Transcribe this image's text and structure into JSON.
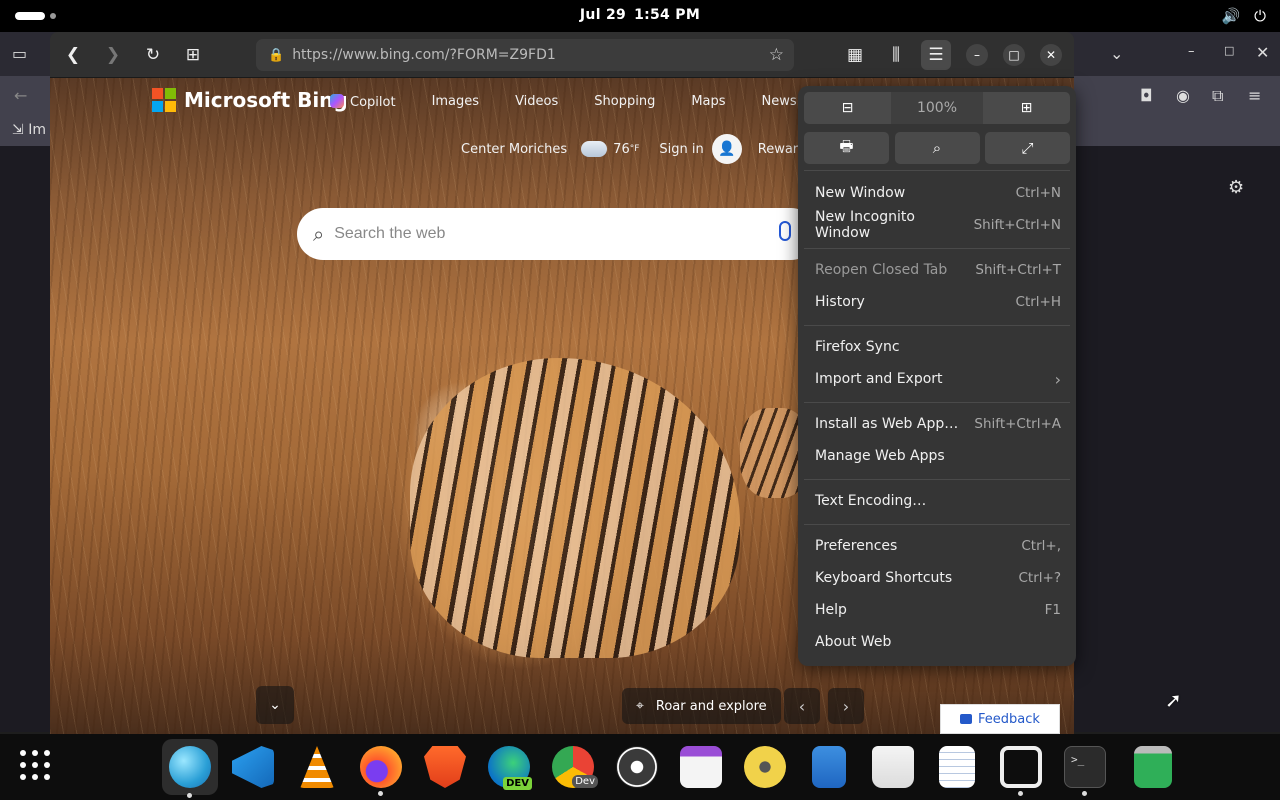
{
  "topbar": {
    "date": "Jul 29",
    "time": "1:54 PM",
    "volume_icon": "speaker-icon",
    "power_icon": "power-icon"
  },
  "firefox_bg": {
    "import_label": "Im"
  },
  "browser": {
    "url": "https://www.bing.com/?FORM=Z9FD1",
    "page": {
      "logo": "Microsoft Bing",
      "nav": [
        "Copilot",
        "Images",
        "Videos",
        "Shopping",
        "Maps",
        "News"
      ],
      "location": "Center Moriches",
      "temp": "76",
      "temp_unit": "°F",
      "sign_in": "Sign in",
      "rewards": "Rewards",
      "search_placeholder": "Search the web",
      "photo_caption": "Roar and explore",
      "feedback": "Feedback"
    }
  },
  "menu": {
    "zoom": "100%",
    "items": [
      {
        "label": "New Window",
        "shortcut": "Ctrl+N"
      },
      {
        "label": "New Incognito Window",
        "shortcut": "Shift+Ctrl+N"
      },
      {
        "label": "Reopen Closed Tab",
        "shortcut": "Shift+Ctrl+T"
      },
      {
        "label": "History",
        "shortcut": "Ctrl+H"
      },
      {
        "label": "Firefox Sync",
        "shortcut": ""
      },
      {
        "label": "Import and Export",
        "shortcut": ""
      },
      {
        "label": "Install as Web App…",
        "shortcut": "Shift+Ctrl+A"
      },
      {
        "label": "Manage Web Apps",
        "shortcut": ""
      },
      {
        "label": "Text Encoding…",
        "shortcut": ""
      },
      {
        "label": "Preferences",
        "shortcut": "Ctrl+,"
      },
      {
        "label": "Keyboard Shortcuts",
        "shortcut": "Ctrl+?"
      },
      {
        "label": "Help",
        "shortcut": "F1"
      },
      {
        "label": "About Web",
        "shortcut": ""
      }
    ]
  },
  "dock": {
    "apps": [
      "Web",
      "Visual Studio Code",
      "VLC",
      "Firefox",
      "Brave",
      "Edge Dev",
      "Chrome Dev",
      "OBS Studio",
      "Calendar",
      "Rhythmbox",
      "Files",
      "Software",
      "Text Editor",
      "Screenshot",
      "Terminal",
      "Trash"
    ],
    "edge_badge": "DEV",
    "chrome_badge": "Dev"
  }
}
